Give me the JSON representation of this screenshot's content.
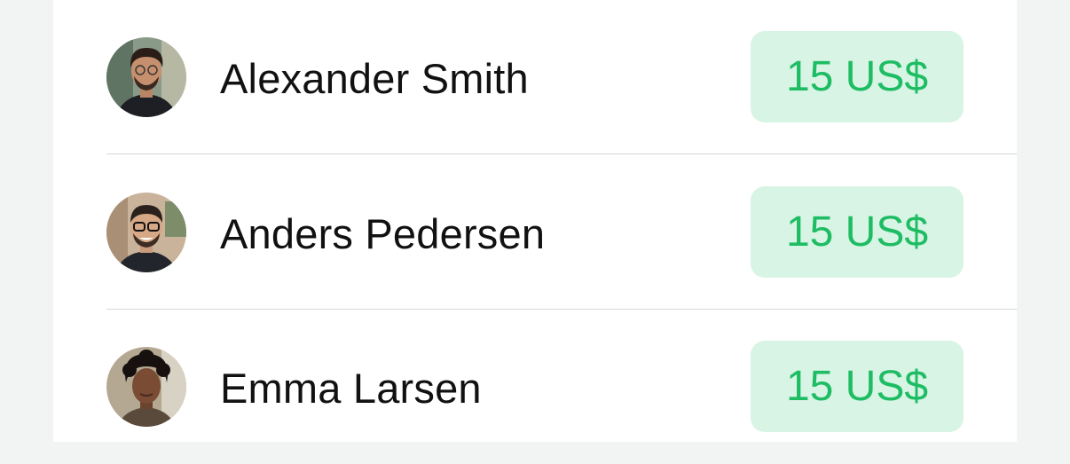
{
  "contacts": [
    {
      "name": "Alexander Smith",
      "amount": "15 US$"
    },
    {
      "name": "Anders Pedersen",
      "amount": "15 US$"
    },
    {
      "name": "Emma Larsen",
      "amount": "15 US$"
    }
  ],
  "colors": {
    "badge_background": "#d8f4e5",
    "badge_text": "#1ebd64",
    "divider": "#d6d6d8",
    "page_background": "#f2f4f3"
  }
}
